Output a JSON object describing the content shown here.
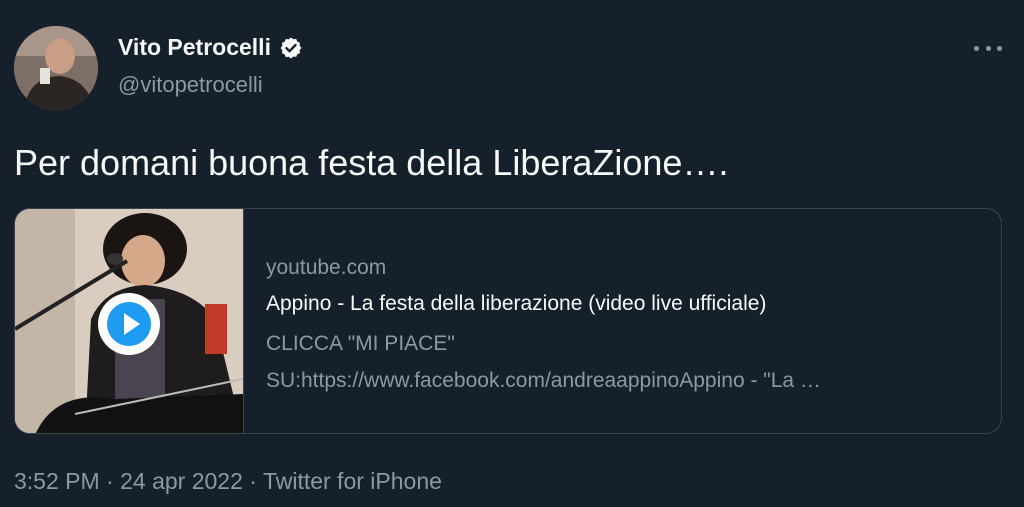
{
  "author": {
    "display_name": "Vito Petrocelli",
    "handle": "@vitopetrocelli",
    "verified": true,
    "avatar_icon": "user-avatar-photo"
  },
  "tweet": {
    "text": "Per domani buona festa della LiberaZione…."
  },
  "card": {
    "domain": "youtube.com",
    "title": "Appino - La festa della liberazione (video live ufficiale)",
    "description_line1": "CLICCA \"MI PIACE\"",
    "description_line2": "SU:https://www.facebook.com/andreaappinoAppino - \"La …",
    "thumbnail_icon": "video-thumbnail",
    "play_icon": "play-icon"
  },
  "meta": {
    "time": "3:52 PM",
    "date": "24 apr 2022",
    "source": "Twitter for iPhone",
    "separator": "·"
  },
  "colors": {
    "background": "#15202b",
    "text_primary": "#f7f9f9",
    "text_secondary": "#8b98a5",
    "border": "#38444d",
    "verified_badge": "#f7f9f9",
    "play_button": "#1d9bf0"
  },
  "icons": {
    "more": "more-icon",
    "verified": "verified-badge-icon"
  }
}
